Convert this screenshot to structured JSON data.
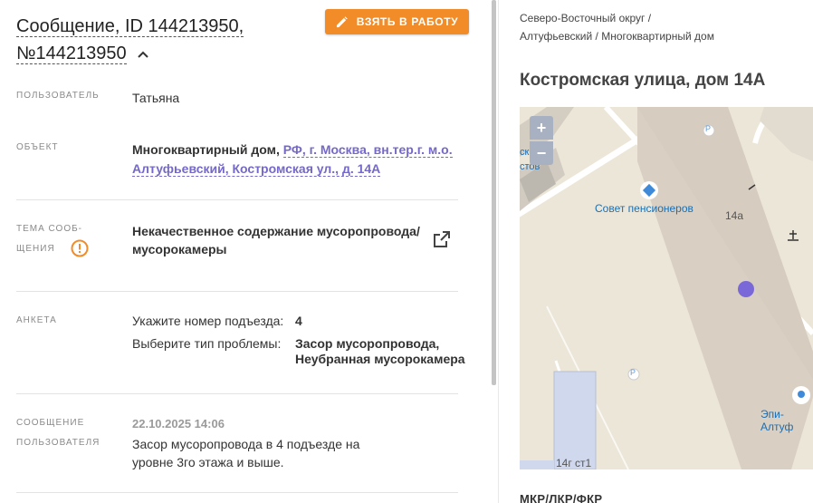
{
  "header": {
    "title_line1": "Сообщение, ID 144213950,",
    "title_line2": "№144213950",
    "take_button_label": "ВЗЯТЬ В РАБОТУ"
  },
  "fields": {
    "user": {
      "label": "ПОЛЬЗОВАТЕЛЬ",
      "value": "Татьяна"
    },
    "object": {
      "label": "ОБЪЕКТ",
      "type": "Многоквартирный дом,",
      "address_line1": "РФ, г. Москва, вн.тер.г. м.о.",
      "address_line2": "Алтуфьевский, Костромская ул., д. 14А"
    },
    "topic": {
      "label_line1": "ТЕМА СООБ-",
      "label_line2": "ЩЕНИЯ",
      "value_line1": "Некачественное содержание мусоропровода/",
      "value_line2": "мусорокамеры"
    },
    "survey": {
      "label": "АНКЕТА",
      "q1": "Укажите номер подъезда:",
      "a1": "4",
      "q2": "Выберите тип проблемы:",
      "a2_line1": "Засор мусоропровода,",
      "a2_line2": "Неубранная мусорокамера"
    },
    "message": {
      "label_line1": "СООБЩЕНИЕ",
      "label_line2": "ПОЛЬЗОВАТЕЛЯ",
      "date": "22.10.2025 14:06",
      "text_line1": "Засор мусоропровода в 4 подъезде на",
      "text_line2": "уровне 3го этажа и выше."
    }
  },
  "right": {
    "breadcrumb_line1": "Северо-Восточный округ /",
    "breadcrumb_line2": "Алтуфьевский / Многоквартирный дом",
    "address": "Костромская улица, дом 14А",
    "bottom_heading": "МКР/ЛКР/ФКР"
  },
  "map": {
    "zoom_in": "+",
    "zoom_out": "−",
    "poi_council": "Совет пенсионеров",
    "house_number": "14а",
    "poi_epi": "Эпи-Алтуф",
    "street_fragment_1": "ской",
    "street_fragment_2": "стов",
    "building_label": "14г ст1",
    "parking_1": "P",
    "parking_2": "P",
    "marker_color": "#7b68d8"
  },
  "colors": {
    "accent_orange": "#f28c28",
    "link_purple": "#7468c8"
  }
}
